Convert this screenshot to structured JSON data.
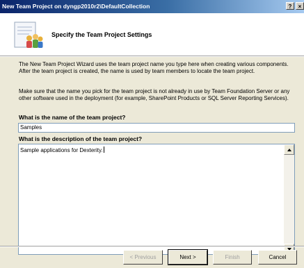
{
  "window": {
    "title": "New Team Project on dyngp2010r2\\DefaultCollection",
    "help_label": "?",
    "close_label": "×"
  },
  "header": {
    "title": "Specify the Team Project Settings",
    "icon": "wizard-document-people-icon"
  },
  "content": {
    "paragraph1": "The New Team Project Wizard uses the team project name you type here when creating various components. After the team project is created, the name is used by team members to locate the team project.",
    "paragraph2": "Make sure that the name you pick for the team project is not already in use by Team Foundation Server or any other software used in the deployment (for example, SharePoint Products or SQL Server Reporting Services).",
    "name_label": "What is the name of the team project?",
    "name_value": "Samples",
    "description_label": "What is the description of the team project?",
    "description_value": "Sample applications for Dexterity."
  },
  "buttons": {
    "previous": "< Previous",
    "next": "Next >",
    "finish": "Finish",
    "cancel": "Cancel"
  },
  "colors": {
    "titlebar_start": "#0a246a",
    "titlebar_end": "#a6caf0",
    "dialog_background": "#ece9d8",
    "input_border": "#7f9db9"
  }
}
